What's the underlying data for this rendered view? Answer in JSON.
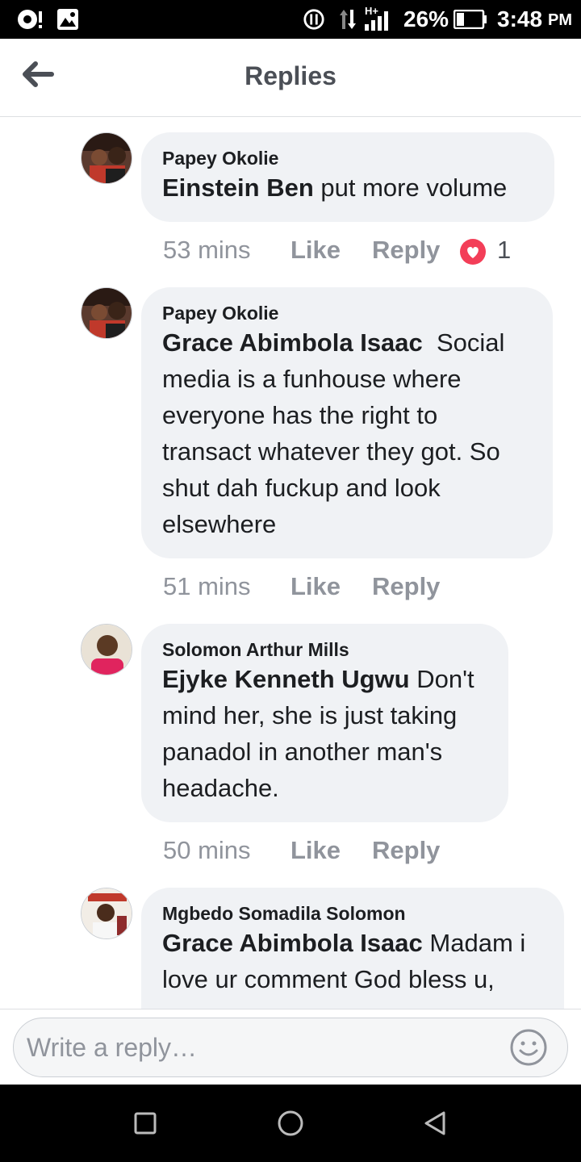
{
  "status_bar": {
    "network": "H+",
    "battery": "26%",
    "time": "3:48",
    "ampm": "PM"
  },
  "header": {
    "title": "Replies"
  },
  "comments": [
    {
      "author": "Papey Okolie",
      "mention": "Einstein Ben",
      "text": " put more volume",
      "time": "53 mins",
      "like": "Like",
      "reply": "Reply",
      "reaction_count": "1"
    },
    {
      "author": "Papey Okolie",
      "mention": "Grace Abimbola Isaac",
      "text": "  Social media is a funhouse where everyone has the right to transact whatever they got. So shut dah fuckup and look elsewhere",
      "time": "51 mins",
      "like": "Like",
      "reply": "Reply"
    },
    {
      "author": "Solomon Arthur Mills",
      "mention": "Ejyke Kenneth Ugwu",
      "text": " Don't mind her, she is just taking panadol in another man's headache.",
      "time": "50 mins",
      "like": "Like",
      "reply": "Reply"
    },
    {
      "author": "Mgbedo Somadila Solomon",
      "mention": "Grace Abimbola Isaac",
      "text": " Madam i love ur comment God bless u,"
    }
  ],
  "composer": {
    "placeholder": "Write a reply…"
  },
  "colors": {
    "bubble": "#f0f2f5",
    "meta_text": "#90949c",
    "heart": "#f33e58"
  }
}
